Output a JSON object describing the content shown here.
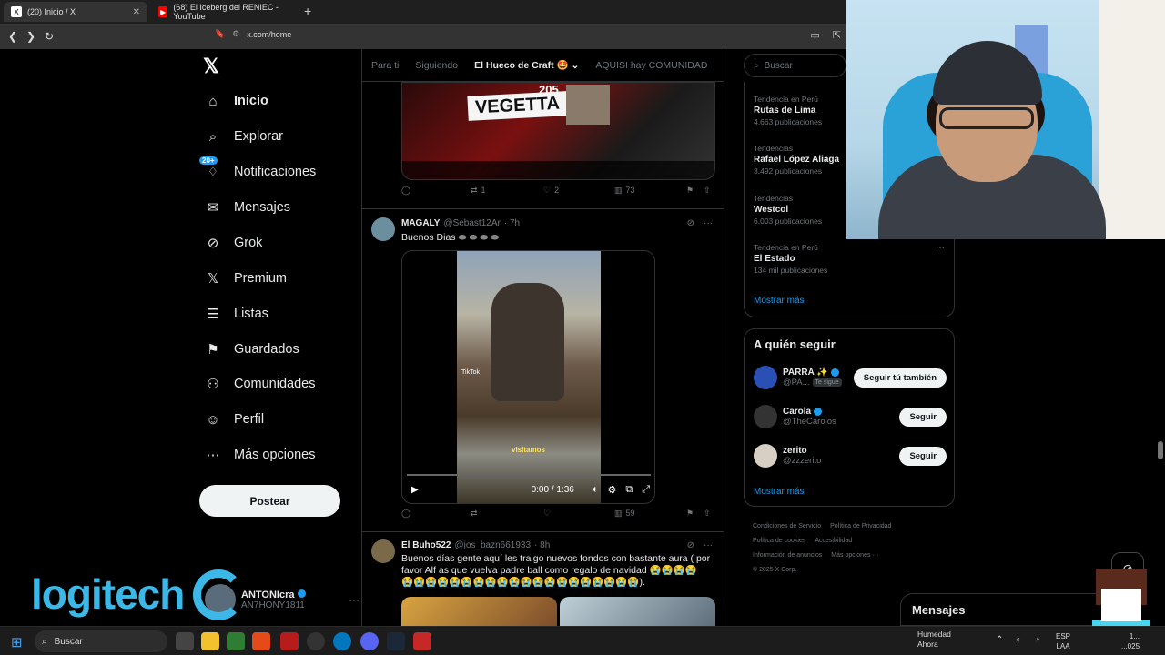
{
  "browser": {
    "tabs": [
      {
        "title": "(20) Inicio / X",
        "favicon": "X",
        "active": true
      },
      {
        "title": "(68) El Iceberg del RENIEC - YouTube",
        "favicon": "▶",
        "active": false
      }
    ],
    "url": "x.com/home"
  },
  "nav": {
    "logo": "𝕏",
    "items": [
      {
        "key": "home",
        "label": "Inicio",
        "icon": "home-icon",
        "glyph": "⌂"
      },
      {
        "key": "explore",
        "label": "Explorar",
        "icon": "search-icon",
        "glyph": "⌕"
      },
      {
        "key": "notifications",
        "label": "Notificaciones",
        "icon": "bell-icon",
        "glyph": "🔔",
        "badge": "20+"
      },
      {
        "key": "messages",
        "label": "Mensajes",
        "icon": "mail-icon",
        "glyph": "✉"
      },
      {
        "key": "grok",
        "label": "Grok",
        "icon": "grok-icon",
        "glyph": "⊘"
      },
      {
        "key": "premium",
        "label": "Premium",
        "icon": "x-icon",
        "glyph": "𝕏"
      },
      {
        "key": "lists",
        "label": "Listas",
        "icon": "list-icon",
        "glyph": "☰"
      },
      {
        "key": "bookmarks",
        "label": "Guardados",
        "icon": "bookmark-icon",
        "glyph": "⚑"
      },
      {
        "key": "communities",
        "label": "Comunidades",
        "icon": "people-icon",
        "glyph": "⚇"
      },
      {
        "key": "profile",
        "label": "Perfil",
        "icon": "user-icon",
        "glyph": "☺"
      },
      {
        "key": "more",
        "label": "Más opciones",
        "icon": "more-icon",
        "glyph": "⋯"
      }
    ],
    "post_label": "Postear",
    "account": {
      "name": "ANTONIcra",
      "handle": "AN7HONY1811"
    }
  },
  "logitech": "logitech",
  "timeline": {
    "tabs": [
      "Para ti",
      "Siguiendo",
      "El Hueco de Craft 🤩",
      "AQUISI hay COMUNIDAD"
    ],
    "tweet1": {
      "media_text": "VEGETTA",
      "media_num": "205",
      "actions": {
        "reply": "",
        "retweet": "1",
        "like": "2",
        "views": "73"
      }
    },
    "tweet2": {
      "name": "MAGALY",
      "handle": "@Sebast12Ar",
      "time": "· 7h",
      "text": "Buenos Dias",
      "video": {
        "caption": "visitamos",
        "watermark": "TikTok",
        "time": "0:00 / 1:36"
      },
      "actions": {
        "reply": "",
        "retweet": "",
        "like": "",
        "views": "59"
      }
    },
    "tweet3": {
      "name": "El Buho522",
      "handle": "@jos_bazn661933",
      "time": "· 8h",
      "text": "Buenos días gente aquí les traigo nuevos fondos con bastante aura ( por favor Alf as que vuelva padre ball como regalo de navidad 😭😭😭😭 😭😭😭😭😭😭😭😭😭😭😭😭😭😭😭😭😭😭😭😭).",
      "media_colors": [
        "#d9a441",
        "#8fa8b8"
      ]
    }
  },
  "sidebar": {
    "search_placeholder": "Buscar",
    "trends": [
      {
        "context": "Tendencia en Perú",
        "name": "Rutas de Lima",
        "count": "4.663 publicaciones"
      },
      {
        "context": "Tendencias",
        "name": "Rafael López Aliaga",
        "count": "3.492 publicaciones"
      },
      {
        "context": "Tendencias",
        "name": "Westcol",
        "count": "6.003 publicaciones"
      },
      {
        "context": "Tendencia en Perú",
        "name": "El Estado",
        "count": "134 mil publicaciones"
      }
    ],
    "trends_more": "Mostrar más",
    "follow_title": "A quién seguir",
    "follow": [
      {
        "name": "PARRA ✨",
        "handle": "@PA...",
        "tag": "Te sigue",
        "button": "Seguir tú también",
        "color": "#2a4fb5"
      },
      {
        "name": "Carola",
        "handle": "@TheCarolos",
        "tag": "",
        "button": "Seguir",
        "color": "#333"
      },
      {
        "name": "zerito",
        "handle": "@zzzerito",
        "tag": "",
        "button": "Seguir",
        "color": "#d8cfc4"
      }
    ],
    "follow_more": "Mostrar más",
    "footer": [
      "Condiciones de Servicio",
      "Política de Privacidad",
      "Política de cookies",
      "Accesibilidad",
      "Información de anuncios",
      "Más opciones ···",
      "© 2025 X Corp."
    ]
  },
  "messages_label": "Mensajes",
  "taskbar": {
    "search": "Buscar",
    "weather": {
      "title": "Humedad",
      "sub": "Ahora"
    },
    "lang": {
      "l1": "ESP",
      "l2": "LAA"
    },
    "clock": {
      "l1": "1...",
      "l2": "...025"
    }
  }
}
